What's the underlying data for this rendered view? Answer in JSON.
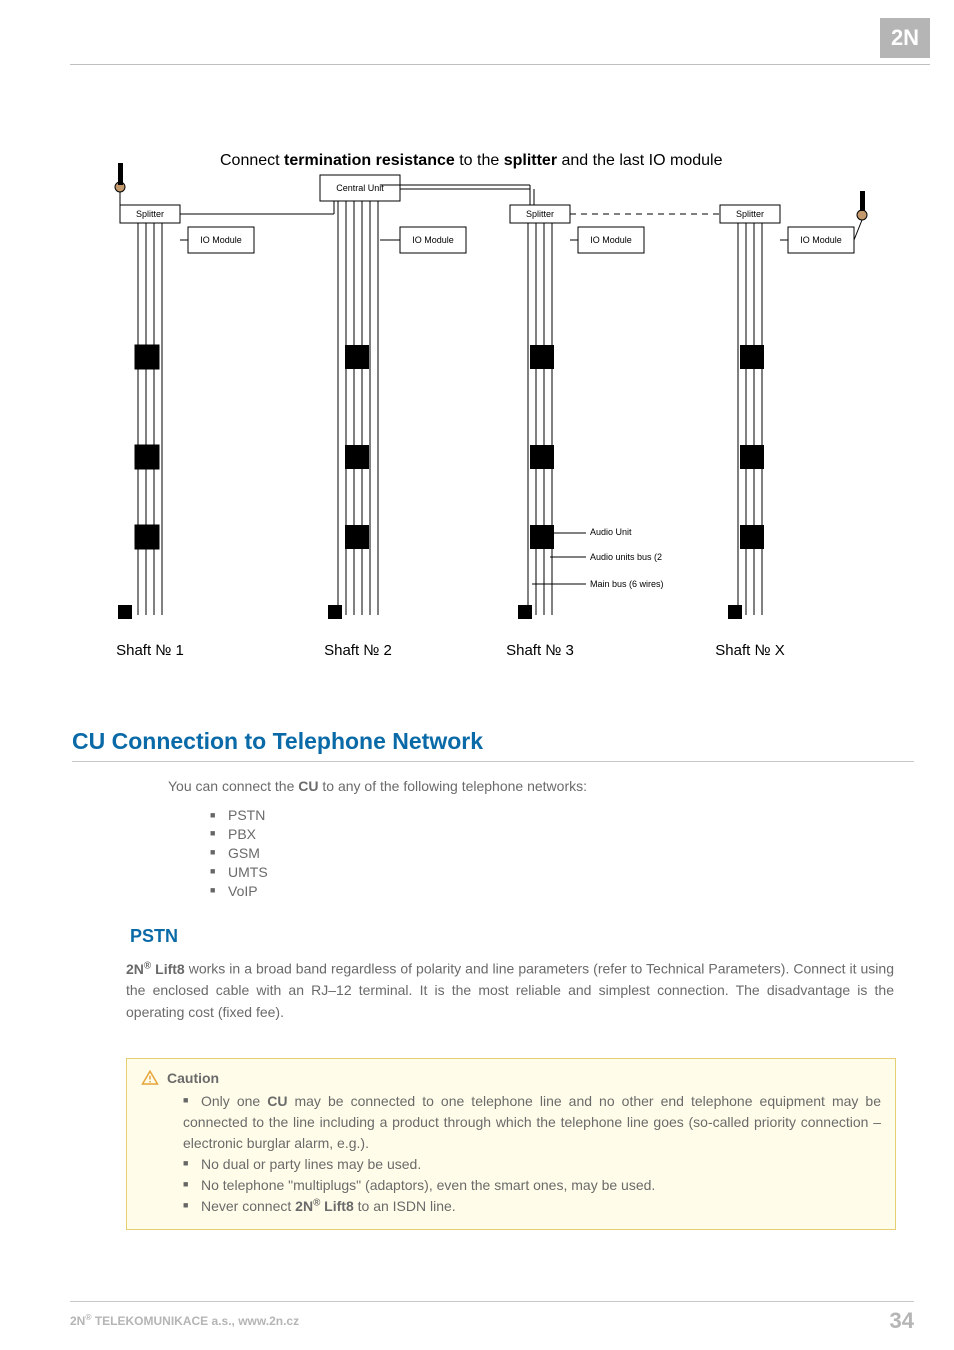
{
  "logo_text": "2N",
  "diagram": {
    "title_plain1": "Connect ",
    "title_bold1": "termination resistance",
    "title_plain2": " to the ",
    "title_bold2": "splitter",
    "title_plain3": " and the last IO module",
    "central_unit": "Central Unit",
    "splitter": "Splitter",
    "io_module": "IO Module",
    "audio_unit": "Audio Unit",
    "audio_bus": "Audio units bus (2",
    "main_bus": "Main bus (6 wires)",
    "shaft1": "Shaft № 1",
    "shaft2": "Shaft № 2",
    "shaft3": "Shaft № 3",
    "shaftx": "Shaft № X"
  },
  "section_heading": "CU Connection to Telephone Network",
  "intro_part1": "You can connect the ",
  "intro_bold": "CU",
  "intro_part2": " to any of the following telephone networks:",
  "networks": {
    "n1": "PSTN",
    "n2": "PBX",
    "n3": "GSM",
    "n4": "UMTS",
    "n5": "VoIP"
  },
  "sub_heading": "PSTN",
  "pstn": {
    "lead_bold": "2N",
    "lead_sup": "®",
    "lead_bold2": " Lift8",
    "body": " works in a broad band regardless of polarity and line parameters (refer to Technical Parameters). Connect it using the enclosed cable with an RJ–12 terminal. It is the most reliable and simplest connection. The disadvantage is the operating cost (fixed fee)."
  },
  "caution": {
    "label": "Caution",
    "b1a": "Only one ",
    "b1bold": "CU",
    "b1b": " may be connected to one telephone line and no other end telephone equipment may be connected to the line including a product through which the telephone line goes (so-called priority connection – electronic burglar alarm, e.g.).",
    "b2": "No dual or party lines may be used.",
    "b3": "No telephone \"multiplugs\" (adaptors), even the smart ones, may be used.",
    "b4a": "Never connect ",
    "b4bold1": "2N",
    "b4sup": "®",
    "b4bold2": " Lift8",
    "b4b": " to an ISDN line."
  },
  "footer": {
    "left_bold": "2N",
    "left_sup": "®",
    "left_rest": " TELEKOMUNIKACE a.s., www.2n.cz",
    "page": "34"
  }
}
